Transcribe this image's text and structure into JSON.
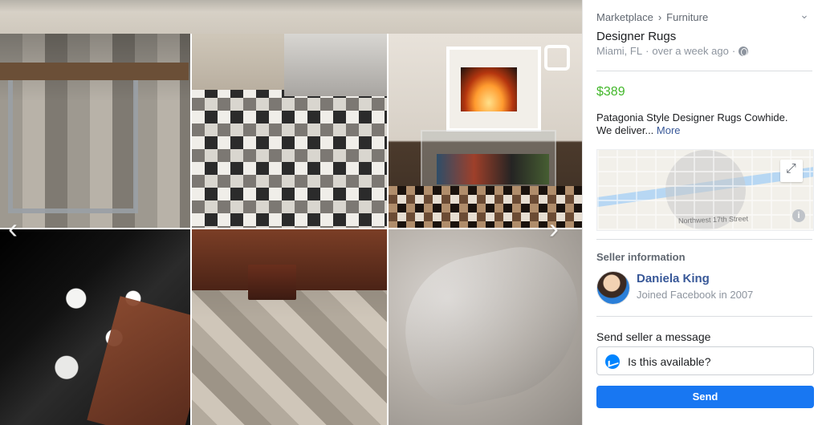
{
  "listing": {
    "breadcrumb": {
      "root": "Marketplace",
      "separator": "›",
      "category": "Furniture"
    },
    "title": "Designer Rugs",
    "meta": {
      "location": "Miami, FL",
      "dot": "·",
      "age": "over a week ago",
      "dot2": "·",
      "visibility_icon": "globe-icon"
    },
    "price": "$389",
    "description": {
      "text": "Patagonia Style Designer Rugs Cowhide. We deliver... ",
      "more_label": "More"
    },
    "map": {
      "street_label": "Northwest 17th Street"
    }
  },
  "seller": {
    "heading": "Seller information",
    "name": "Daniela King",
    "joined": "Joined Facebook in 2007"
  },
  "message": {
    "heading": "Send seller a message",
    "input_value": "Is this available?",
    "send_label": "Send"
  },
  "ui": {
    "prev_arrow": "‹",
    "next_arrow": "›",
    "collapse": "⌄",
    "info": "i"
  },
  "colors": {
    "price_green": "#42b72a",
    "link_blue": "#385898",
    "send_blue": "#1877f2",
    "messenger_blue": "#0084ff"
  }
}
